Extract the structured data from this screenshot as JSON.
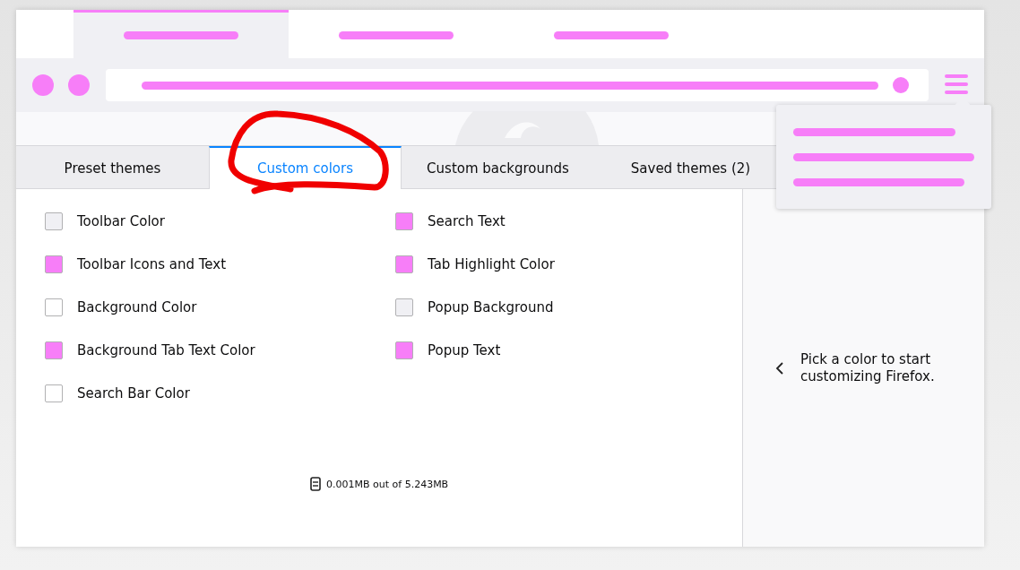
{
  "preview": {
    "tabs": [
      {
        "selected": true
      },
      {
        "selected": false
      },
      {
        "selected": false
      }
    ]
  },
  "tabs": [
    {
      "label": "Preset themes",
      "selected": false
    },
    {
      "label": "Custom colors",
      "selected": true
    },
    {
      "label": "Custom backgrounds",
      "selected": false
    },
    {
      "label": "Saved themes (2)",
      "selected": false
    }
  ],
  "colors": [
    {
      "label": "Toolbar Color",
      "color": "#f0f0f4"
    },
    {
      "label": "Search Text",
      "color": "#f77ef8"
    },
    {
      "label": "Toolbar Icons and Text",
      "color": "#f77ef8"
    },
    {
      "label": "Tab Highlight Color",
      "color": "#f77ef8"
    },
    {
      "label": "Background Color",
      "color": "#ffffff"
    },
    {
      "label": "Popup Background",
      "color": "#f0f0f4"
    },
    {
      "label": "Background Tab Text Color",
      "color": "#f77ef8"
    },
    {
      "label": "Popup Text",
      "color": "#f77ef8"
    },
    {
      "label": "Search Bar Color",
      "color": "#ffffff"
    }
  ],
  "storage": "0.001MB out of 5.243MB",
  "hint": "Pick a color to start customizing Firefox."
}
